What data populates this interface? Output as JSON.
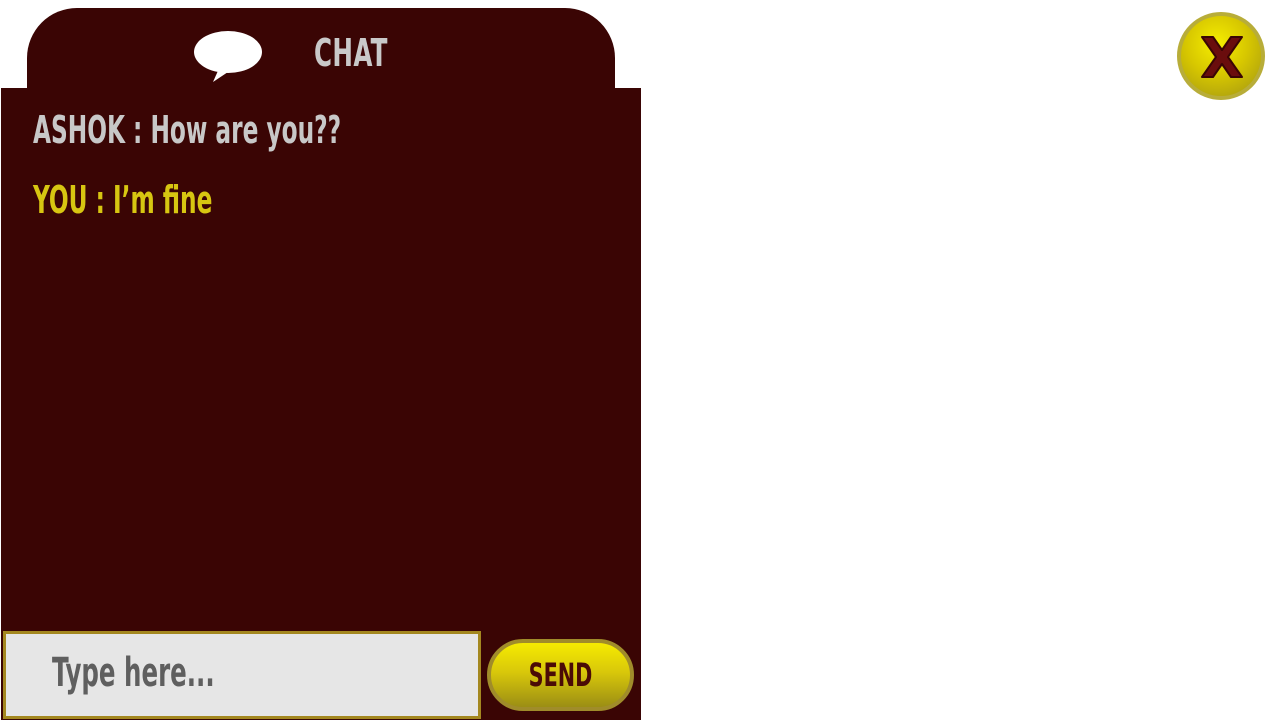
{
  "chat": {
    "title": "CHAT",
    "messages": [
      {
        "speaker": "ASHOK",
        "text": "ASHOK : How are you??"
      },
      {
        "speaker": "YOU",
        "text": "YOU : I’m fine"
      }
    ],
    "input_placeholder": "Type here...",
    "send_label": "SEND"
  },
  "icons": {
    "chat": "speech-bubble-icon",
    "close": "close-icon"
  },
  "colors": {
    "panel": "#3a0504",
    "other_message": "#c8c8c8",
    "self_message": "#d7c611",
    "accent_yellow": "#f6eb00"
  }
}
